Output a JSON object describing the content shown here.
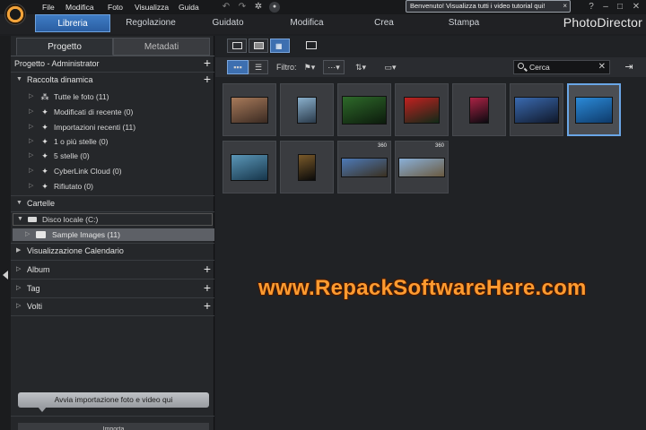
{
  "menu": {
    "items": [
      "File",
      "Modifica",
      "Foto",
      "Visualizza",
      "Guida"
    ]
  },
  "welcome_tip": {
    "text": "Benvenuto! Visualizza tutti i video tutorial qui!",
    "close": "×"
  },
  "window": {
    "help": "?",
    "minimize": "–",
    "maximize": "□",
    "close": "✕"
  },
  "module_tabs": [
    {
      "label": "Libreria",
      "active": true
    },
    {
      "label": "Regolazione",
      "active": false
    },
    {
      "label": "Guidato",
      "active": false
    },
    {
      "label": "Modifica",
      "active": false
    },
    {
      "label": "Crea",
      "active": false
    },
    {
      "label": "Stampa",
      "active": false
    }
  ],
  "brand": "PhotoDirector",
  "left_panel": {
    "tabs": [
      {
        "label": "Progetto",
        "active": true
      },
      {
        "label": "Metadati",
        "active": false
      }
    ],
    "project_header": "Progetto - Administrator",
    "smart_collection": {
      "label": "Raccolta dinamica",
      "items": [
        {
          "label": "Tutte le foto (11)",
          "icon": "all-photos-icon"
        },
        {
          "label": "Modificati di recente (0)",
          "icon": "recently-edited-icon"
        },
        {
          "label": "Importazioni recenti (11)",
          "icon": "recent-imports-icon"
        },
        {
          "label": "1 o più stelle (0)",
          "icon": "star-icon"
        },
        {
          "label": "5 stelle (0)",
          "icon": "star-icon"
        },
        {
          "label": "CyberLink Cloud (0)",
          "icon": "cloud-icon"
        },
        {
          "label": "Rifiutato (0)",
          "icon": "rejected-icon"
        }
      ]
    },
    "folders": {
      "label": "Cartelle",
      "disk": "Disco locale (C:)",
      "sample": "Sample Images (11)"
    },
    "sections": [
      {
        "label": "Visualizzazione Calendario",
        "plus": false
      },
      {
        "label": "Album",
        "plus": true
      },
      {
        "label": "Tag",
        "plus": true
      },
      {
        "label": "Volti",
        "plus": true
      }
    ],
    "import_button": "Avvia importazione foto e video qui",
    "import_label": "Importa"
  },
  "toolbar": {
    "filter_label": "Filtro:",
    "search_value": "Cerca"
  },
  "thumbnails": [
    {
      "name": "photo-cityscape",
      "colors": [
        "#a87a5a",
        "#3a2a22"
      ],
      "w": 42,
      "h": 30,
      "badge": ""
    },
    {
      "name": "photo-statue",
      "colors": [
        "#8ab0cc",
        "#2a3a4a"
      ],
      "w": 22,
      "h": 30,
      "badge": ""
    },
    {
      "name": "photo-forest",
      "colors": [
        "#2e6a2a",
        "#0c1a0c"
      ],
      "w": 50,
      "h": 32,
      "badge": ""
    },
    {
      "name": "photo-red-flower",
      "colors": [
        "#c22020",
        "#0f2a18"
      ],
      "w": 40,
      "h": 30,
      "badge": ""
    },
    {
      "name": "photo-neon-sign",
      "colors": [
        "#aa2244",
        "#0a0a10"
      ],
      "w": 22,
      "h": 30,
      "badge": ""
    },
    {
      "name": "photo-city-night",
      "colors": [
        "#3a6ab0",
        "#10182a"
      ],
      "w": 50,
      "h": 30,
      "badge": ""
    },
    {
      "name": "photo-skateboarder",
      "colors": [
        "#2b8ad8",
        "#0e3a6a"
      ],
      "w": 42,
      "h": 30,
      "badge": ""
    },
    {
      "name": "photo-wave",
      "colors": [
        "#5b97b8",
        "#16354a"
      ],
      "w": 42,
      "h": 30,
      "badge": ""
    },
    {
      "name": "photo-doorway",
      "colors": [
        "#7a5a2a",
        "#0a0a0a"
      ],
      "w": 20,
      "h": 30,
      "badge": ""
    },
    {
      "name": "photo-panorama-mountains",
      "colors": [
        "#4d7ab8",
        "#3a3020"
      ],
      "w": 52,
      "h": 22,
      "badge": "360"
    },
    {
      "name": "photo-panorama-hills",
      "colors": [
        "#8ab0d8",
        "#6a5a40"
      ],
      "w": 52,
      "h": 22,
      "badge": "360"
    }
  ],
  "watermark": "www.RepackSoftwareHere.com",
  "colors": {
    "accent": "#3d6fb0",
    "selected_border": "#6aa6e6",
    "watermark": "#ff9b30"
  }
}
